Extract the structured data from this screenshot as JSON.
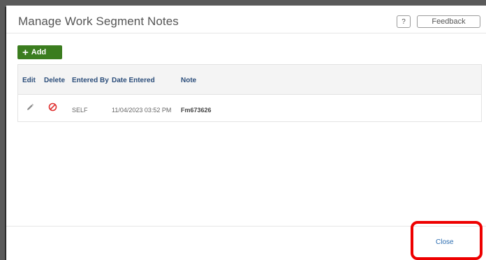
{
  "dialog": {
    "title": "Manage Work Segment Notes",
    "help_label": "?",
    "feedback_label": "Feedback"
  },
  "toolbar": {
    "add_label": "Add",
    "add_icon": "plus-icon"
  },
  "grid": {
    "columns": [
      "Edit",
      "Delete",
      "Entered By",
      "Date Entered",
      "Note"
    ],
    "rows": [
      {
        "edit_icon": "pencil-icon",
        "delete_icon": "prohibited-icon",
        "entered_by": "SELF",
        "date_entered": "11/04/2023 03:52 PM",
        "note": "Fm673626"
      }
    ]
  },
  "footer": {
    "close_label": "Close"
  },
  "colors": {
    "accent_green": "#3b7d1f",
    "header_text_blue": "#2b4d7a",
    "delete_red": "#e03030",
    "highlight_red": "#ee0000"
  }
}
